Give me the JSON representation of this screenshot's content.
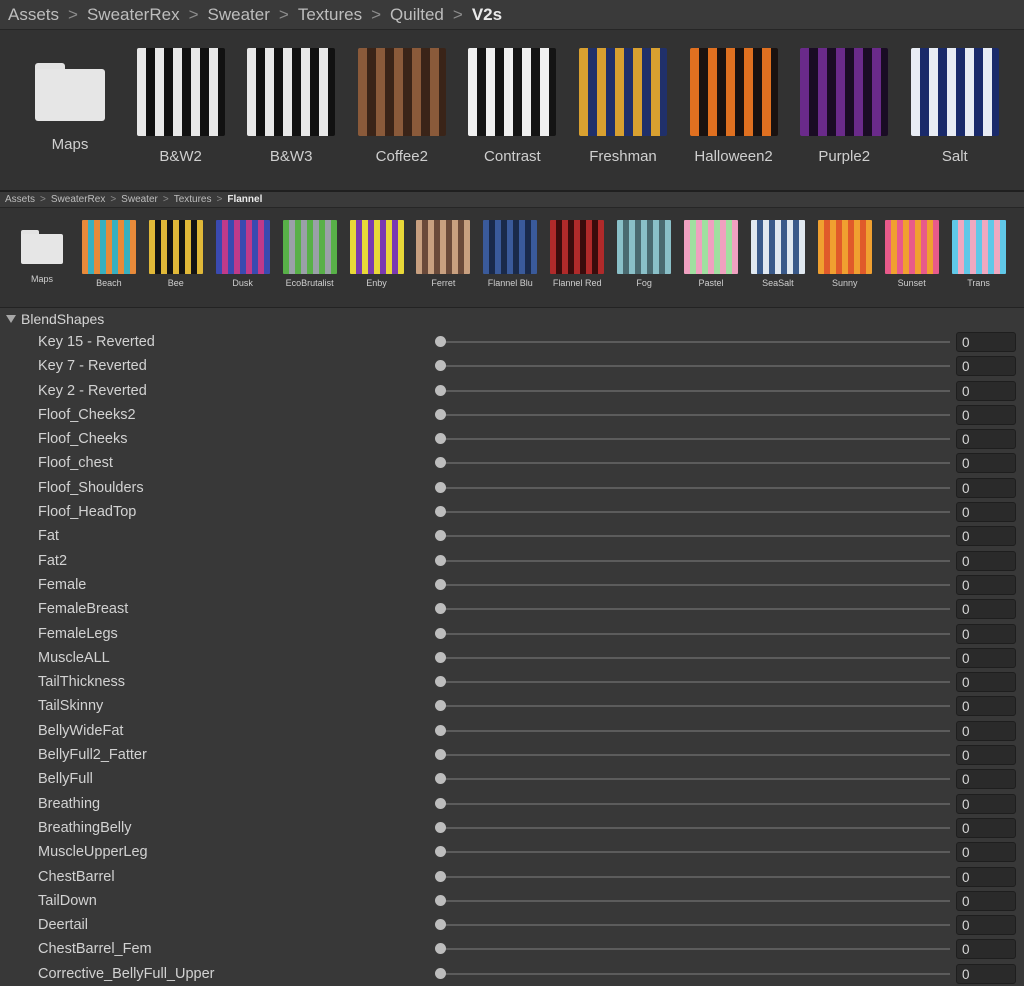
{
  "top_breadcrumb": [
    "Assets",
    "SweaterRex",
    "Sweater",
    "Textures",
    "Quilted",
    "V2s"
  ],
  "top_items": [
    {
      "label": "Maps",
      "kind": "folder"
    },
    {
      "label": "B&W2",
      "kind": "texture",
      "colors": [
        "#e8e8e8",
        "#111111"
      ]
    },
    {
      "label": "B&W3",
      "kind": "texture",
      "colors": [
        "#e8e8e8",
        "#111111"
      ]
    },
    {
      "label": "Coffee2",
      "kind": "texture",
      "colors": [
        "#8a5a3a",
        "#3a2418"
      ]
    },
    {
      "label": "Contrast",
      "kind": "texture",
      "colors": [
        "#f0f0f0",
        "#141414"
      ]
    },
    {
      "label": "Freshman",
      "kind": "texture",
      "colors": [
        "#d8a030",
        "#20306a"
      ]
    },
    {
      "label": "Halloween2",
      "kind": "texture",
      "colors": [
        "#e07020",
        "#1a1210"
      ]
    },
    {
      "label": "Purple2",
      "kind": "texture",
      "colors": [
        "#6a2a8a",
        "#1a0c24"
      ]
    },
    {
      "label": "Salt",
      "kind": "texture",
      "colors": [
        "#e8ecf4",
        "#1a2a6a"
      ]
    }
  ],
  "mid_breadcrumb": [
    "Assets",
    "SweaterRex",
    "Sweater",
    "Textures",
    "Flannel"
  ],
  "mid_items": [
    {
      "label": "Maps",
      "kind": "folder"
    },
    {
      "label": "Beach",
      "kind": "texture",
      "colors": [
        "#e88a3a",
        "#38b0c0"
      ]
    },
    {
      "label": "Bee",
      "kind": "texture",
      "colors": [
        "#e0b838",
        "#141414"
      ]
    },
    {
      "label": "Dusk",
      "kind": "texture",
      "colors": [
        "#3a4ab0",
        "#c03a8a"
      ]
    },
    {
      "label": "EcoBrutalist",
      "kind": "texture",
      "colors": [
        "#58b048",
        "#9aa0a8"
      ]
    },
    {
      "label": "Enby",
      "kind": "texture",
      "colors": [
        "#e8d838",
        "#7a3ab0"
      ]
    },
    {
      "label": "Ferret",
      "kind": "texture",
      "colors": [
        "#c8a080",
        "#6a4a3a"
      ]
    },
    {
      "label": "Flannel Blu",
      "kind": "texture",
      "colors": [
        "#3a5a9a",
        "#1a2a4a"
      ]
    },
    {
      "label": "Flannel Red",
      "kind": "texture",
      "colors": [
        "#b02a2a",
        "#3a0c0c"
      ]
    },
    {
      "label": "Fog",
      "kind": "texture",
      "colors": [
        "#8ac0c8",
        "#4a6a70"
      ]
    },
    {
      "label": "Pastel",
      "kind": "texture",
      "colors": [
        "#f0a0c0",
        "#a0e0a0"
      ]
    },
    {
      "label": "SeaSalt",
      "kind": "texture",
      "colors": [
        "#e0e8f0",
        "#3a5a8a"
      ]
    },
    {
      "label": "Sunny",
      "kind": "texture",
      "colors": [
        "#f0a030",
        "#e05a2a"
      ]
    },
    {
      "label": "Sunset",
      "kind": "texture",
      "colors": [
        "#e85a8a",
        "#f0a030"
      ]
    },
    {
      "label": "Trans",
      "kind": "texture",
      "colors": [
        "#60c8e8",
        "#f0a8c0"
      ]
    }
  ],
  "blendshapes": {
    "header": "BlendShapes",
    "rows": [
      {
        "name": "Key 15 - Reverted",
        "value": "0"
      },
      {
        "name": "Key 7 - Reverted",
        "value": "0"
      },
      {
        "name": "Key 2 - Reverted",
        "value": "0"
      },
      {
        "name": "Floof_Cheeks2",
        "value": "0"
      },
      {
        "name": "Floof_Cheeks",
        "value": "0"
      },
      {
        "name": "Floof_chest",
        "value": "0"
      },
      {
        "name": "Floof_Shoulders",
        "value": "0"
      },
      {
        "name": "Floof_HeadTop",
        "value": "0"
      },
      {
        "name": "Fat",
        "value": "0"
      },
      {
        "name": "Fat2",
        "value": "0"
      },
      {
        "name": "Female",
        "value": "0"
      },
      {
        "name": "FemaleBreast",
        "value": "0"
      },
      {
        "name": "FemaleLegs",
        "value": "0"
      },
      {
        "name": "MuscleALL",
        "value": "0"
      },
      {
        "name": "TailThickness",
        "value": "0"
      },
      {
        "name": "TailSkinny",
        "value": "0"
      },
      {
        "name": "BellyWideFat",
        "value": "0"
      },
      {
        "name": "BellyFull2_Fatter",
        "value": "0"
      },
      {
        "name": "BellyFull",
        "value": "0"
      },
      {
        "name": "Breathing",
        "value": "0"
      },
      {
        "name": "BreathingBelly",
        "value": "0"
      },
      {
        "name": "MuscleUpperLeg",
        "value": "0"
      },
      {
        "name": "ChestBarrel",
        "value": "0"
      },
      {
        "name": "TailDown",
        "value": "0"
      },
      {
        "name": "Deertail",
        "value": "0"
      },
      {
        "name": "ChestBarrel_Fem",
        "value": "0"
      },
      {
        "name": "Corrective_BellyFull_Upper",
        "value": "0"
      }
    ]
  }
}
